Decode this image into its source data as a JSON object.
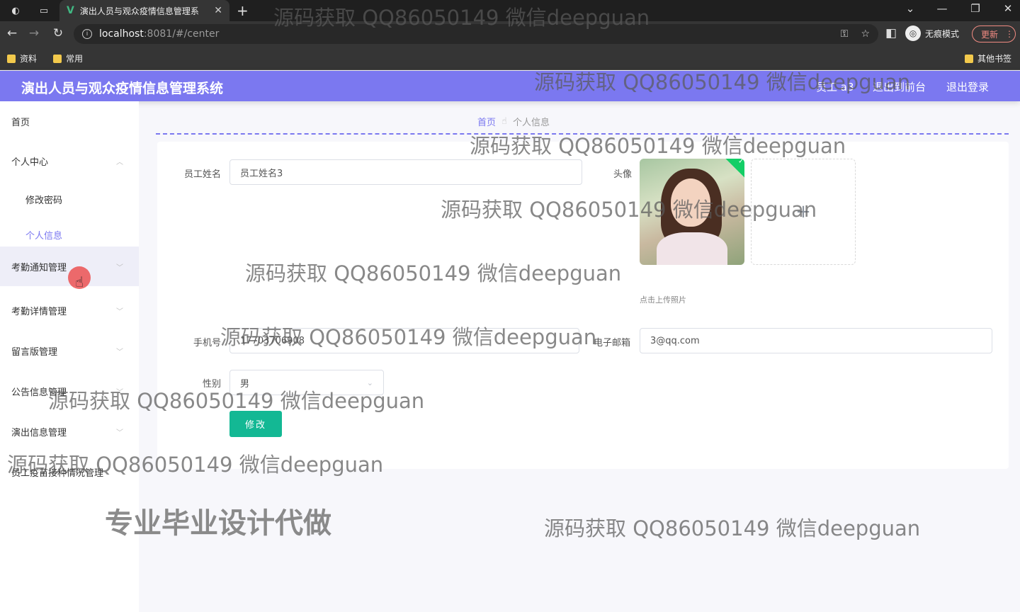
{
  "browser": {
    "tab_title": "演出人员与观众疫情信息管理系",
    "tab_logo": "V",
    "url_host": "localhost",
    "url_path": ":8081/#/center",
    "incognito_label": "无痕模式",
    "update_label": "更新",
    "bookmarks": [
      "资料",
      "常用"
    ],
    "other_bookmarks": "其他书签"
  },
  "header": {
    "title": "演出人员与观众疫情信息管理系统",
    "user": "员工 a3",
    "back_to_front": "退出到前台",
    "logout": "退出登录"
  },
  "sidebar": {
    "items": [
      {
        "label": "首页"
      },
      {
        "label": "个人中心"
      },
      {
        "label": "修改密码"
      },
      {
        "label": "个人信息"
      },
      {
        "label": "考勤通知管理"
      },
      {
        "label": "考勤详情管理"
      },
      {
        "label": "留言版管理"
      },
      {
        "label": "公告信息管理"
      },
      {
        "label": "演出信息管理"
      },
      {
        "label": "员工疫苗接种情况管理"
      }
    ]
  },
  "breadcrumb": {
    "home": "首页",
    "current": "个人信息"
  },
  "form": {
    "name_label": "员工姓名",
    "name_value": "员工姓名3",
    "avatar_label": "头像",
    "upload_tip": "点击上传照片",
    "phone_label": "手机号",
    "phone_value": "17703706908",
    "email_label": "电子邮箱",
    "email_value": "3@qq.com",
    "gender_label": "性别",
    "gender_value": "男",
    "submit_label": "修改"
  },
  "watermarks": {
    "text": "源码获取 QQ86050149 微信deepguan",
    "big": "专业毕业设计代做"
  },
  "colors": {
    "accent": "#7b78f0",
    "submit": "#13b894"
  }
}
